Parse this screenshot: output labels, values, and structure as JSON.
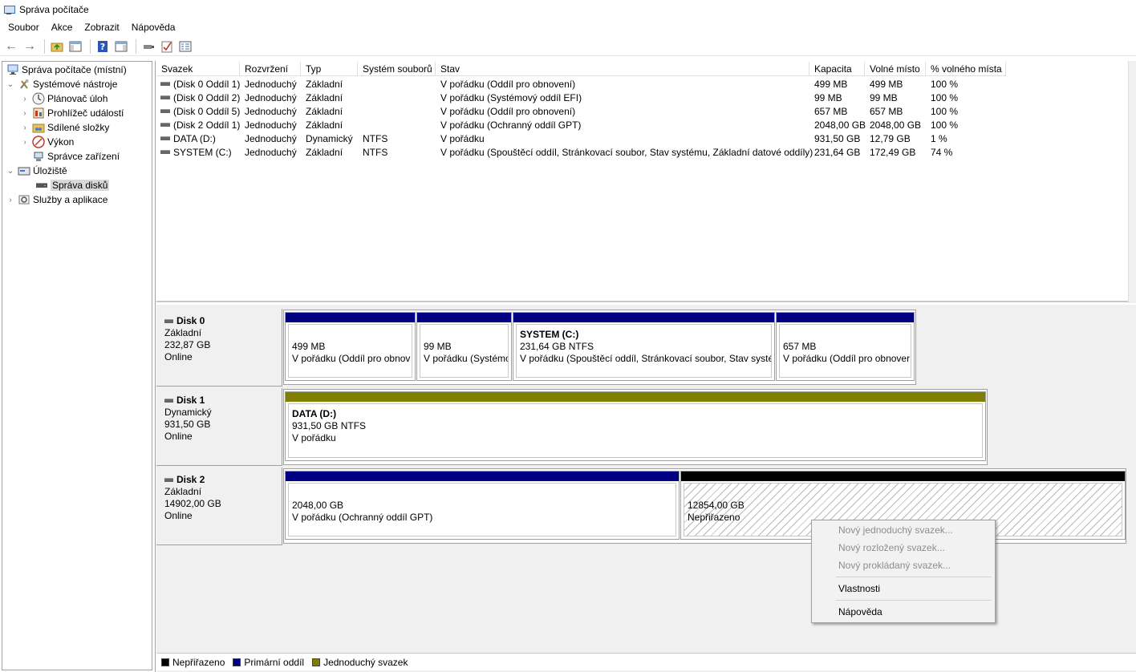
{
  "window": {
    "title": "Správa počítače"
  },
  "menu": [
    "Soubor",
    "Akce",
    "Zobrazit",
    "Nápověda"
  ],
  "toolbar": {
    "icons": [
      "back-arrow",
      "forward-arrow",
      "up-folder",
      "show-hide-tree",
      "help",
      "show-hide-action-pane",
      "connect",
      "check",
      "properties"
    ]
  },
  "tree": {
    "root": "Správa počítače (místní)",
    "system_tools": "Systémové nástroje",
    "task_scheduler": "Plánovač úloh",
    "event_viewer": "Prohlížeč událostí",
    "shared_folders": "Sdílené složky",
    "performance": "Výkon",
    "device_manager": "Správce zařízení",
    "storage": "Úložiště",
    "disk_management": "Správa disků",
    "services": "Služby a aplikace"
  },
  "volumes": {
    "headers": {
      "volume": "Svazek",
      "layout": "Rozvržení",
      "type": "Typ",
      "fs": "Systém souborů",
      "status": "Stav",
      "capacity": "Kapacita",
      "free": "Volné místo",
      "pct": "% volného místa"
    },
    "rows": [
      {
        "volume": "(Disk 0 Oddíl 1)",
        "layout": "Jednoduchý",
        "type": "Základní",
        "fs": "",
        "status": "V pořádku (Oddíl pro obnovení)",
        "capacity": "499 MB",
        "free": "499 MB",
        "pct": "100 %"
      },
      {
        "volume": "(Disk 0 Oddíl 2)",
        "layout": "Jednoduchý",
        "type": "Základní",
        "fs": "",
        "status": "V pořádku (Systémový oddíl EFI)",
        "capacity": "99 MB",
        "free": "99 MB",
        "pct": "100 %"
      },
      {
        "volume": "(Disk 0 Oddíl 5)",
        "layout": "Jednoduchý",
        "type": "Základní",
        "fs": "",
        "status": "V pořádku (Oddíl pro obnovení)",
        "capacity": "657 MB",
        "free": "657 MB",
        "pct": "100 %"
      },
      {
        "volume": "(Disk 2 Oddíl 1)",
        "layout": "Jednoduchý",
        "type": "Základní",
        "fs": "",
        "status": "V pořádku (Ochranný oddíl GPT)",
        "capacity": "2048,00 GB",
        "free": "2048,00 GB",
        "pct": "100 %"
      },
      {
        "volume": "DATA (D:)",
        "layout": "Jednoduchý",
        "type": "Dynamický",
        "fs": "NTFS",
        "status": "V pořádku",
        "capacity": "931,50 GB",
        "free": "12,79 GB",
        "pct": "1 %"
      },
      {
        "volume": "SYSTEM (C:)",
        "layout": "Jednoduchý",
        "type": "Základní",
        "fs": "NTFS",
        "status": "V pořádku (Spouštěcí oddíl, Stránkovací soubor, Stav systému, Základní datové oddíly)",
        "capacity": "231,64 GB",
        "free": "172,49 GB",
        "pct": "74 %"
      }
    ]
  },
  "disks": [
    {
      "name": "Disk 0",
      "kind": "Základní",
      "size": "232,87 GB",
      "state": "Online",
      "parts": [
        {
          "title": "",
          "size": "499 MB",
          "status": "V pořádku (Oddíl pro obnov"
        },
        {
          "title": "",
          "size": "99 MB",
          "status": "V pořádku (Systémo"
        },
        {
          "title": "SYSTEM  (C:)",
          "size": "231,64 GB NTFS",
          "status": "V pořádku (Spouštěcí oddíl, Stránkovací soubor, Stav systér"
        },
        {
          "title": "",
          "size": "657 MB",
          "status": "V pořádku (Oddíl pro obnover"
        }
      ]
    },
    {
      "name": "Disk 1",
      "kind": "Dynamický",
      "size": "931,50 GB",
      "state": "Online",
      "parts": [
        {
          "title": "DATA  (D:)",
          "size": "931,50 GB NTFS",
          "status": "V pořádku"
        }
      ]
    },
    {
      "name": "Disk 2",
      "kind": "Základní",
      "size": "14902,00 GB",
      "state": "Online",
      "parts": [
        {
          "title": "",
          "size": "2048,00 GB",
          "status": "V pořádku (Ochranný oddíl GPT)"
        },
        {
          "title": "",
          "size": "12854,00 GB",
          "status": "Nepřiřazeno"
        }
      ]
    }
  ],
  "legend": {
    "unallocated": "Nepřiřazeno",
    "primary": "Primární oddíl",
    "simple": "Jednoduchý svazek"
  },
  "colors": {
    "unallocated": "#000000",
    "primary": "#000080",
    "simple": "#808000"
  },
  "context_menu": {
    "new_simple": "Nový jednoduchý svazek...",
    "new_spanned": "Nový rozložený svazek...",
    "new_striped": "Nový prokládaný svazek...",
    "properties": "Vlastnosti",
    "help": "Nápověda"
  }
}
